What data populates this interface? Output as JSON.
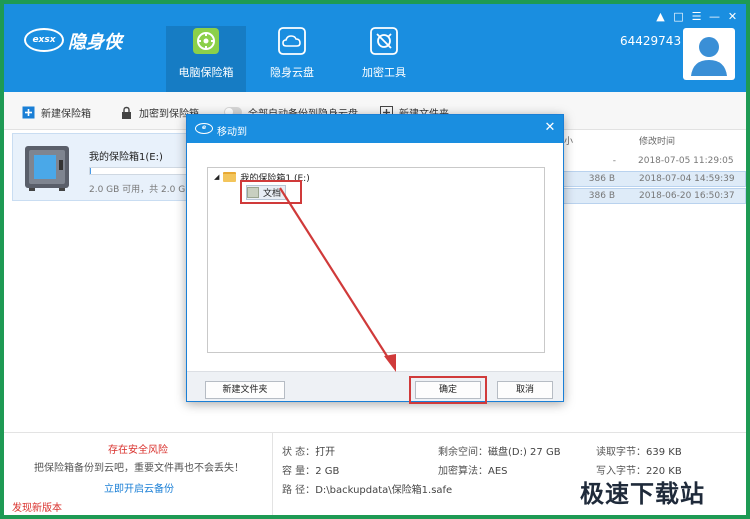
{
  "header": {
    "logo_mark": "exsx",
    "logo_name": "隐身侠",
    "nav": [
      {
        "label": "电脑保险箱",
        "icon": "vault-icon",
        "active": true
      },
      {
        "label": "隐身云盘",
        "icon": "cloud-icon",
        "active": false
      },
      {
        "label": "加密工具",
        "icon": "tools-icon",
        "active": false
      }
    ],
    "user_id": "64429743",
    "window_controls": [
      "shirt-icon",
      "message-icon",
      "menu-icon",
      "minimize-icon",
      "close-icon"
    ]
  },
  "toolbar": {
    "new_vault": "新建保险箱",
    "encrypt_to_vault": "加密到保险箱",
    "auto_backup": "全部自动备份到隐身云盘",
    "new_folder": "新建文件夹"
  },
  "vault": {
    "name": "我的保险箱1(E:)",
    "capacity": "2.0 GB 可用，共 2.0 G",
    "used_fraction": 0.01
  },
  "file_list": {
    "headers": [
      "小",
      "修改时间"
    ],
    "rows": [
      {
        "size": "-",
        "date": "2018-07-05 11:29:05",
        "selected": false
      },
      {
        "size": "386 B",
        "date": "2018-07-04 14:59:39",
        "selected": true
      },
      {
        "size": "386 B",
        "date": "2018-06-20 16:50:37",
        "selected": true
      }
    ]
  },
  "bottom": {
    "risk_title": "存在安全风险",
    "risk_desc": "把保险箱备份到云吧，重要文件再也不会丢失！",
    "risk_link": "立即开启云备份",
    "new_version": "发现新版本",
    "info": {
      "status_k": "状    态：",
      "status_v": "打开",
      "capacity_k": "容    量：",
      "capacity_v": "2 GB",
      "path_k": "路    径：",
      "path_v": "D:\\backupdata\\保险箱1.safe",
      "free_k": "剩余空间：",
      "free_v": "磁盘(D:) 27 GB",
      "algo_k": "加密算法：",
      "algo_v": "AES",
      "read_k": "读取字节：",
      "read_v": "639 KB",
      "write_k": "写入字节：",
      "write_v": "220 KB"
    }
  },
  "dialog": {
    "title": "移动到",
    "tree_root": "我的保险箱1 (E:)",
    "tree_child": "文档",
    "new_folder_btn": "新建文件夹",
    "ok_btn": "确定",
    "cancel_btn": "取消"
  },
  "colors": {
    "header_blue": "#1a8ee0",
    "frame_green": "#1e9a54",
    "highlight_red": "#d03a3a"
  },
  "watermark": "极速下载站"
}
